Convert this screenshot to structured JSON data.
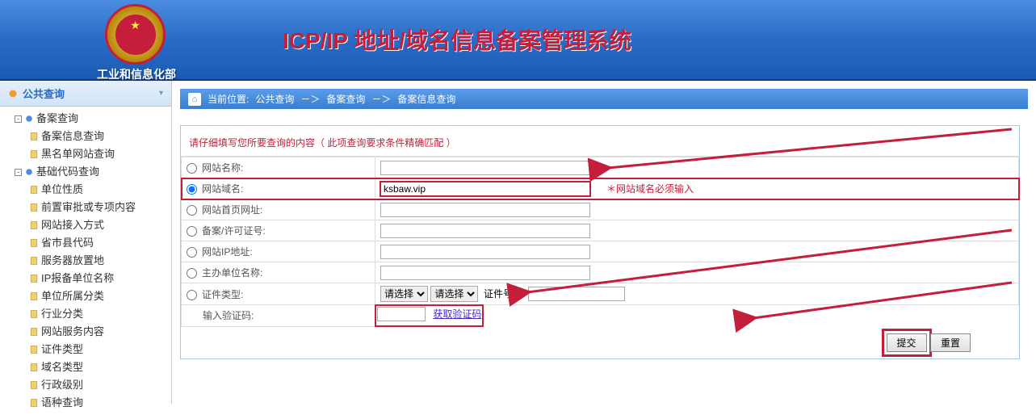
{
  "header": {
    "dept": "工业和信息化部",
    "title": "ICP/IP 地址/域名信息备案管理系统"
  },
  "sidebar": {
    "header": "公共查询",
    "groups": [
      {
        "toggle": "-",
        "label": "备案查询",
        "items": [
          "备案信息查询",
          "黑名单网站查询"
        ]
      },
      {
        "toggle": "-",
        "label": "基础代码查询",
        "items": [
          "单位性质",
          "前置审批或专项内容",
          "网站接入方式",
          "省市县代码",
          "服务器放置地",
          "IP报备单位名称",
          "单位所属分类",
          "行业分类",
          "网站服务内容",
          "证件类型",
          "域名类型",
          "行政级别",
          "语种查询"
        ]
      }
    ]
  },
  "breadcrumb": {
    "loc": "当前位置:",
    "p1": "公共查询",
    "sep": "－＞",
    "p2": "备案查询",
    "p3": "备案信息查询"
  },
  "form": {
    "notice": "请仔细填写您所要查询的内容（ 此项查询要求条件精确匹配 ）",
    "rows": {
      "site_name": "网站名称:",
      "domain": "网站域名:",
      "domain_val": "ksbaw.vip",
      "domain_hint": "＊网站域名必须输入",
      "homepage": "网站首页网址:",
      "license": "备案/许可证号:",
      "ip": "网站IP地址:",
      "sponsor": "主办单位名称:",
      "cert_type": "证件类型:",
      "select_ph": "请选择",
      "cert_no": "证件号码:",
      "captcha": "输入验证码:",
      "captcha_link": "获取验证码"
    },
    "buttons": {
      "submit": "提交",
      "reset": "重置"
    }
  }
}
